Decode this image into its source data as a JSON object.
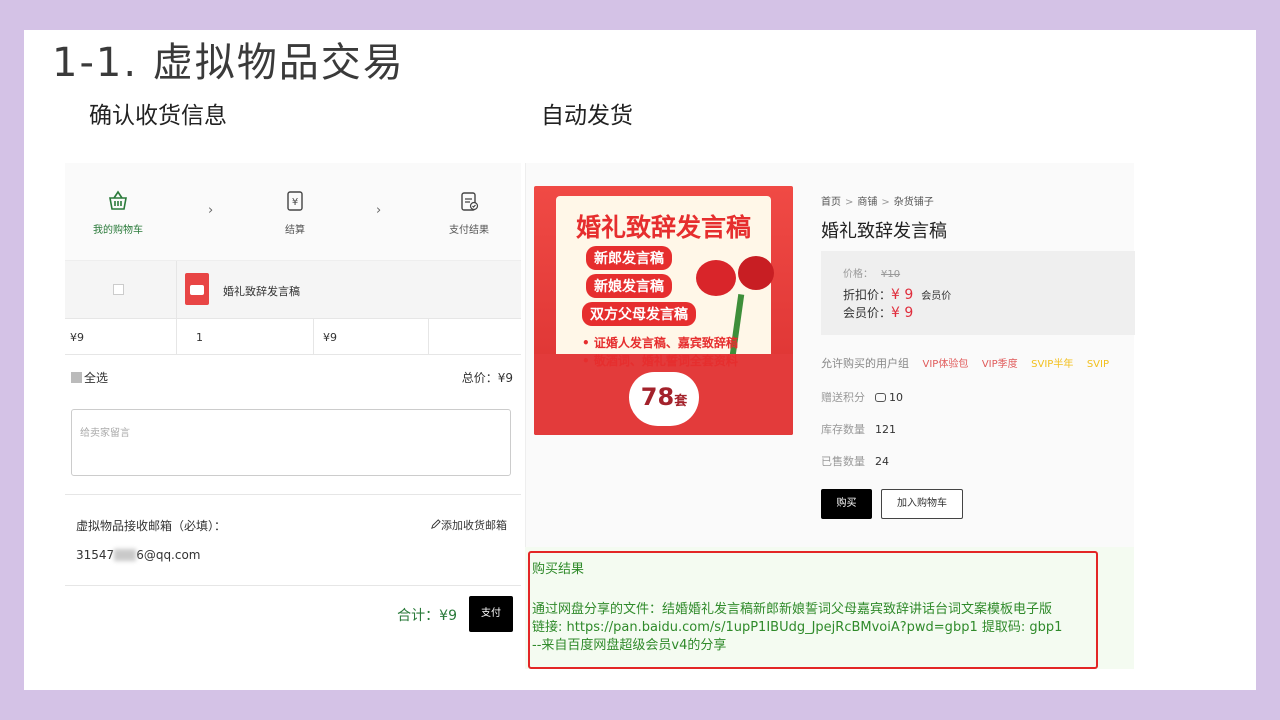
{
  "title": "1-1. 虚拟物品交易",
  "left_subtitle": "确认收货信息",
  "right_subtitle": "自动发货",
  "steps": [
    "我的购物车",
    "结算",
    "支付结果"
  ],
  "step_sep": "›",
  "product": {
    "name": "婚礼致辞发言稿",
    "price": "¥9",
    "qty": "1",
    "subtotal": "¥9"
  },
  "select_all": "全选",
  "total": "总价：¥9",
  "message_placeholder": "给卖家留言",
  "email_section": {
    "label": "虚拟物品接收邮箱（必填）：",
    "add_link": "添加收货邮箱",
    "email_prefix": "31547",
    "email_suffix": "6@qq.com"
  },
  "sum": "合计：¥9",
  "pay_button": "支付",
  "detail": {
    "breadcrumb": [
      "首页",
      "商铺",
      "杂货铺子"
    ],
    "breadcrumb_sep": ">",
    "title": "婚礼致辞发言稿",
    "orig_label": "价格：",
    "orig_price": "¥10",
    "discount_label": "折扣价：",
    "discount_price": "¥ 9",
    "member_tag": "会员价",
    "member_label": "会员价：",
    "member_price": "¥ 9",
    "groups_label": "允许购买的用户组",
    "groups": [
      {
        "name": "VIP体验包",
        "color": "#e05a5a"
      },
      {
        "name": "VIP季度",
        "color": "#e05a5a"
      },
      {
        "name": "SVIP半年",
        "color": "#f2c01e"
      },
      {
        "name": "SVIP",
        "color": "#f2c01e"
      }
    ],
    "points_label": "赠送积分",
    "points": "10",
    "stock_label": "库存数量",
    "stock": "121",
    "sold_label": "已售数量",
    "sold": "24",
    "buy_button": "购买",
    "cart_button": "加入购物车"
  },
  "poster": {
    "title": "婚礼致辞发言稿",
    "pills": [
      "新郎发言稿",
      "新娘发言稿",
      "双方父母发言稿"
    ],
    "bullets": [
      "• 证婚人发言稿、嘉宾致辞稿",
      "• 敬酒词、婚礼誓词全套资料"
    ],
    "count": "78",
    "count_unit": "套"
  },
  "result": {
    "heading": "购买结果",
    "lines": [
      "通过网盘分享的文件：结婚婚礼发言稿新郎新娘誓词父母嘉宾致辞讲话台词文案模板电子版",
      "链接: https://pan.baidu.com/s/1upP1IBUdg_JpejRcBMvoiA?pwd=gbp1 提取码: gbp1",
      "--来自百度网盘超级会员v4的分享"
    ]
  },
  "colors": {
    "accent_green": "#2a7a3a",
    "price_red": "#e02e3d",
    "highlight_box": "#e32626",
    "background": "#d4c2e6"
  }
}
